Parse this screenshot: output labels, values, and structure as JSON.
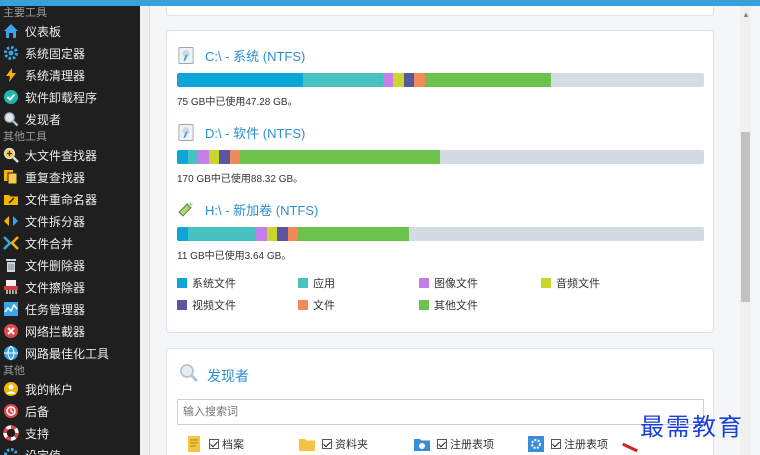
{
  "sidebar": {
    "sections": [
      {
        "title": "主要工具",
        "items": [
          {
            "label": "仪表板",
            "icon": "home-icon"
          },
          {
            "label": "系统固定器",
            "icon": "gear-icon"
          },
          {
            "label": "系统清理器",
            "icon": "lightning-icon"
          },
          {
            "label": "软件卸载程序",
            "icon": "check-circle-icon"
          },
          {
            "label": "发现者",
            "icon": "search-icon"
          }
        ]
      },
      {
        "title": "其他工具",
        "items": [
          {
            "label": "大文件查找器",
            "icon": "magnifier-plus-icon"
          },
          {
            "label": "重复查找器",
            "icon": "duplicate-files-icon"
          },
          {
            "label": "文件重命名器",
            "icon": "rename-folder-icon"
          },
          {
            "label": "文件拆分器",
            "icon": "split-icon"
          },
          {
            "label": "文件合并",
            "icon": "merge-icon"
          },
          {
            "label": "文件删除器",
            "icon": "trash-icon"
          },
          {
            "label": "文件擦除器",
            "icon": "shredder-icon"
          },
          {
            "label": "任务管理器",
            "icon": "chart-icon"
          },
          {
            "label": "网络拦截器",
            "icon": "block-icon"
          },
          {
            "label": "网路最佳化工具",
            "icon": "globe-icon"
          }
        ]
      },
      {
        "title": "其他",
        "items": [
          {
            "label": "我的帐户",
            "icon": "user-icon"
          },
          {
            "label": "后备",
            "icon": "backup-icon"
          },
          {
            "label": "支持",
            "icon": "lifebuoy-icon"
          },
          {
            "label": "设定值",
            "icon": "settings-icon"
          }
        ]
      }
    ]
  },
  "drives": [
    {
      "name": "C:\\ - 系统 (NTFS)",
      "usage": "75 GB中已使用47.28 GB。",
      "icon": "hdd-icon",
      "segments": [
        0.24,
        0.15,
        0.02,
        0.02,
        0.02,
        0.02,
        0.24
      ]
    },
    {
      "name": "D:\\ - 软件 (NTFS)",
      "usage": "170 GB中已使用88.32 GB。",
      "icon": "hdd-icon",
      "segments": [
        0.02,
        0.02,
        0.02,
        0.02,
        0.02,
        0.02,
        0.38
      ]
    },
    {
      "name": "H:\\ - 新加卷 (NTFS)",
      "usage": "11 GB中已使用3.64 GB。",
      "icon": "usb-drive-icon",
      "segments": [
        0.02,
        0.13,
        0.02,
        0.02,
        0.02,
        0.02,
        0.21
      ]
    }
  ],
  "legend": [
    {
      "label": "系统文件",
      "color": "#0ea5d8"
    },
    {
      "label": "应用",
      "color": "#46c3c0"
    },
    {
      "label": "图像文件",
      "color": "#c47fe8"
    },
    {
      "label": "音频文件",
      "color": "#c8d62e"
    },
    {
      "label": "视频文件",
      "color": "#5c56a0"
    },
    {
      "label": "文件",
      "color": "#f08a5a"
    },
    {
      "label": "其他文件",
      "color": "#6cc24a"
    }
  ],
  "finder": {
    "title": "发现者",
    "search_placeholder": "输入搜索词",
    "filters": [
      {
        "label": "档案",
        "icon": "document-icon"
      },
      {
        "label": "资料夹",
        "icon": "folder-icon"
      },
      {
        "label": "注册表项",
        "icon": "registry-key-icon"
      },
      {
        "label": "注册表项",
        "icon": "registry-value-icon"
      }
    ]
  },
  "watermark": "最需教育"
}
